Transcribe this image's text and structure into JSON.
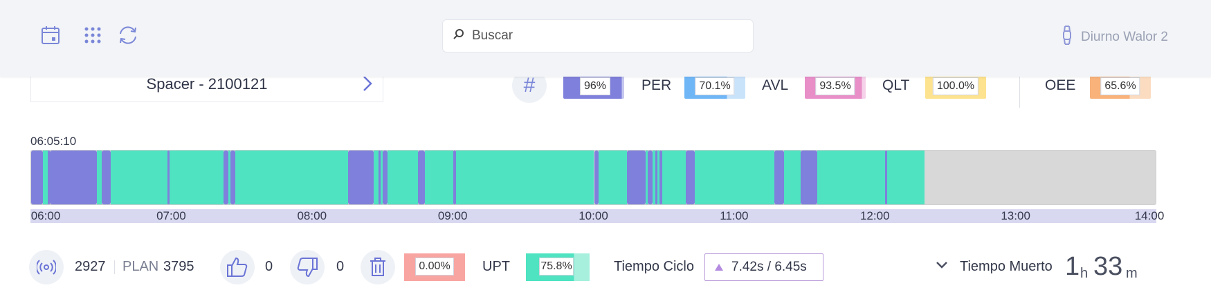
{
  "topbar": {
    "icons": [
      "calendar-icon",
      "grid-icon",
      "refresh-icon"
    ],
    "search_placeholder": "Buscar",
    "device_name": "Diurno Walor 2"
  },
  "product": {
    "name": "Spacer - 2100121"
  },
  "kpis": [
    {
      "label": "",
      "value": "96%",
      "fraction": 0.96,
      "color": "#7f80db",
      "bg": "#c6c7ef"
    },
    {
      "label": "PER",
      "value": "70.1%",
      "fraction": 0.701,
      "color": "#6fb6f6",
      "bg": "#c9e3fb"
    },
    {
      "label": "AVL",
      "value": "93.5%",
      "fraction": 0.935,
      "color": "#e88fc8",
      "bg": "#f6d1ea"
    },
    {
      "label": "QLT",
      "value": "100.0%",
      "fraction": 1.0,
      "color": "#fde28f",
      "bg": "#fdf0c8"
    },
    {
      "label": "OEE",
      "value": "65.6%",
      "fraction": 0.656,
      "color": "#f8b27a",
      "bg": "#fbdcc0"
    }
  ],
  "timeline": {
    "start_label": "06:05:10",
    "hours": [
      "06:00",
      "07:00",
      "08:00",
      "09:00",
      "10:00",
      "11:00",
      "12:00",
      "13:00",
      "14:00"
    ],
    "colors": {
      "running": "#4fe3c1",
      "stopped": "#7f80db",
      "empty": "#d8d8d8"
    },
    "segments": [
      [
        "06:00",
        "06:05",
        "s"
      ],
      [
        "06:05",
        "06:07",
        "r"
      ],
      [
        "06:07",
        "06:08",
        "s"
      ],
      [
        "06:08",
        "06:28",
        "s"
      ],
      [
        "06:28",
        "06:30",
        "r"
      ],
      [
        "06:30",
        "06:34",
        "s"
      ],
      [
        "06:34",
        "06:58",
        "r"
      ],
      [
        "06:58",
        "06:59",
        "s"
      ],
      [
        "06:59",
        "07:22",
        "r"
      ],
      [
        "07:22",
        "07:24",
        "s"
      ],
      [
        "07:24",
        "07:25",
        "r"
      ],
      [
        "07:25",
        "07:27",
        "s"
      ],
      [
        "07:27",
        "08:15",
        "r"
      ],
      [
        "08:15",
        "08:26",
        "s"
      ],
      [
        "08:26",
        "08:28",
        "r"
      ],
      [
        "08:28",
        "08:29",
        "s"
      ],
      [
        "08:29",
        "08:30",
        "r"
      ],
      [
        "08:30",
        "08:32",
        "s"
      ],
      [
        "08:32",
        "08:45",
        "r"
      ],
      [
        "08:45",
        "08:48",
        "s"
      ],
      [
        "08:48",
        "09:00",
        "r"
      ],
      [
        "09:00",
        "09:01",
        "s"
      ],
      [
        "09:01",
        "10:00",
        "r"
      ],
      [
        "10:00",
        "10:02",
        "s"
      ],
      [
        "10:02",
        "10:14",
        "r"
      ],
      [
        "10:14",
        "10:22",
        "s"
      ],
      [
        "10:22",
        "10:23",
        "r"
      ],
      [
        "10:23",
        "10:25",
        "s"
      ],
      [
        "10:25",
        "10:26",
        "r"
      ],
      [
        "10:26",
        "10:27",
        "s"
      ],
      [
        "10:27",
        "10:28",
        "r"
      ],
      [
        "10:28",
        "10:29",
        "s"
      ],
      [
        "10:29",
        "10:39",
        "r"
      ],
      [
        "10:39",
        "10:43",
        "s"
      ],
      [
        "10:43",
        "11:17",
        "r"
      ],
      [
        "11:17",
        "11:21",
        "s"
      ],
      [
        "11:21",
        "11:28",
        "r"
      ],
      [
        "11:28",
        "11:35",
        "s"
      ],
      [
        "11:35",
        "12:04",
        "r"
      ],
      [
        "12:04",
        "12:05",
        "s"
      ],
      [
        "12:05",
        "12:21",
        "r"
      ]
    ],
    "range": [
      "06:00",
      "14:00"
    ]
  },
  "bottom": {
    "produced": "2927",
    "plan_label": "PLAN",
    "plan": "3795",
    "good": "0",
    "bad": "0",
    "scrap_pct": "0.00%",
    "scrap_color": "#f8a5a2",
    "upt_label": "UPT",
    "upt_value": "75.8%",
    "upt_fraction": 0.758,
    "upt_color": "#4fe3c1",
    "upt_bg": "#a6f0dd",
    "ciclo_label": "Tiempo Ciclo",
    "ciclo_value": "7.42s / 6.45s",
    "muerto_label": "Tiempo Muerto",
    "muerto_hours": "1",
    "muerto_h_unit": "h",
    "muerto_minutes": "33",
    "muerto_m_unit": "m"
  }
}
